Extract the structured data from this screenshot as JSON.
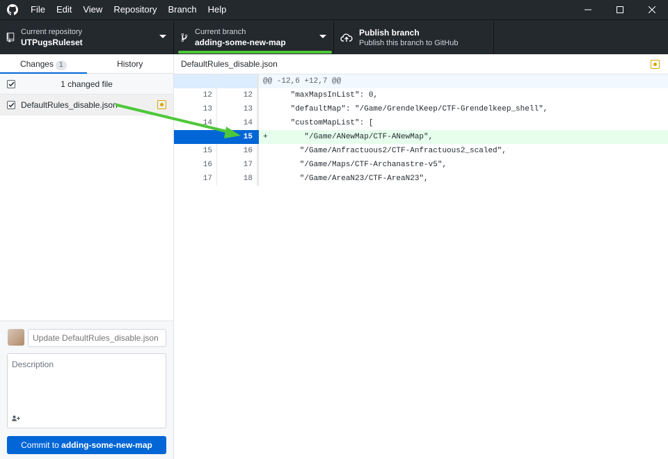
{
  "app": {
    "menu": [
      "File",
      "Edit",
      "View",
      "Repository",
      "Branch",
      "Help"
    ]
  },
  "toolbar": {
    "repo_label": "Current repository",
    "repo_name": "UTPugsRuleset",
    "branch_label": "Current branch",
    "branch_name": "adding-some-new-map",
    "publish_title": "Publish branch",
    "publish_sub": "Publish this branch to GitHub"
  },
  "sidebar": {
    "tab_changes": "Changes",
    "tab_changes_count": "1",
    "tab_history": "History",
    "changed_files_header": "1 changed file",
    "files": [
      {
        "name": "DefaultRules_disable.json"
      }
    ]
  },
  "commit": {
    "summary_placeholder": "Update DefaultRules_disable.json",
    "description_placeholder": "Description",
    "button_prefix": "Commit to ",
    "button_branch": "adding-some-new-map"
  },
  "diff": {
    "filename": "DefaultRules_disable.json",
    "hunk": "@@ -12,6 +12,7 @@",
    "lines": [
      {
        "old": "12",
        "new": "12",
        "code": "      \"maxMapsInList\": 0,",
        "type": "ctx"
      },
      {
        "old": "13",
        "new": "13",
        "code": "      \"defaultMap\": \"/Game/GrendelKeep/CTF-Grendelkeep_shell\",",
        "type": "ctx"
      },
      {
        "old": "14",
        "new": "14",
        "code": "      \"customMapList\": [",
        "type": "ctx"
      },
      {
        "old": "",
        "new": "15",
        "code": "+        \"/Game/ANewMap/CTF-ANewMap\",",
        "type": "add"
      },
      {
        "old": "15",
        "new": "16",
        "code": "        \"/Game/Anfractuous2/CTF-Anfractuous2_scaled\",",
        "type": "ctx"
      },
      {
        "old": "16",
        "new": "17",
        "code": "        \"/Game/Maps/CTF-Archanastre-v5\",",
        "type": "ctx"
      },
      {
        "old": "17",
        "new": "18",
        "code": "        \"/Game/AreaN23/CTF-AreaN23\",",
        "type": "ctx"
      }
    ]
  },
  "colors": {
    "accent": "#0366d6",
    "branch_highlight": "#4ec73a",
    "modified": "#d6a500",
    "added_bg": "#e6ffed"
  }
}
